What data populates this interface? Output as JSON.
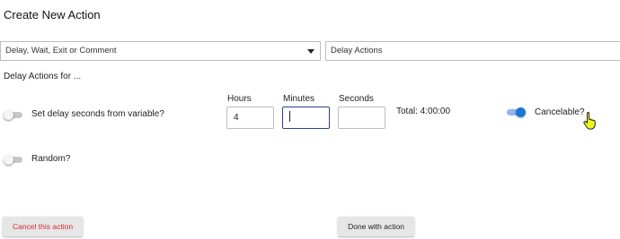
{
  "dialog": {
    "title": "Create New Action"
  },
  "action_type_select": {
    "value": "Delay, Wait, Exit or Comment"
  },
  "action_select": {
    "value": "Delay Actions"
  },
  "section": {
    "heading": "Delay Actions for ..."
  },
  "options": {
    "delay_from_variable": {
      "label": "Set delay seconds from variable?",
      "enabled": false
    },
    "random": {
      "label": "Random?",
      "enabled": false
    },
    "cancelable": {
      "label": "Cancelable?",
      "enabled": true
    }
  },
  "time": {
    "hours": {
      "label": "Hours",
      "value": "4"
    },
    "minutes": {
      "label": "Minutes",
      "value": ""
    },
    "seconds": {
      "label": "Seconds",
      "value": ""
    },
    "total": "Total: 4:00:00"
  },
  "buttons": {
    "cancel": "Cancel this action",
    "done": "Done with action"
  },
  "colors": {
    "accent": "#1e73d8",
    "cancel_text": "#d32f2f",
    "focus_border": "#2f3f99",
    "pointer": "#f2f51a"
  },
  "icons": {
    "dropdown": "caret-down-icon",
    "pointer": "hand-pointer-icon"
  }
}
